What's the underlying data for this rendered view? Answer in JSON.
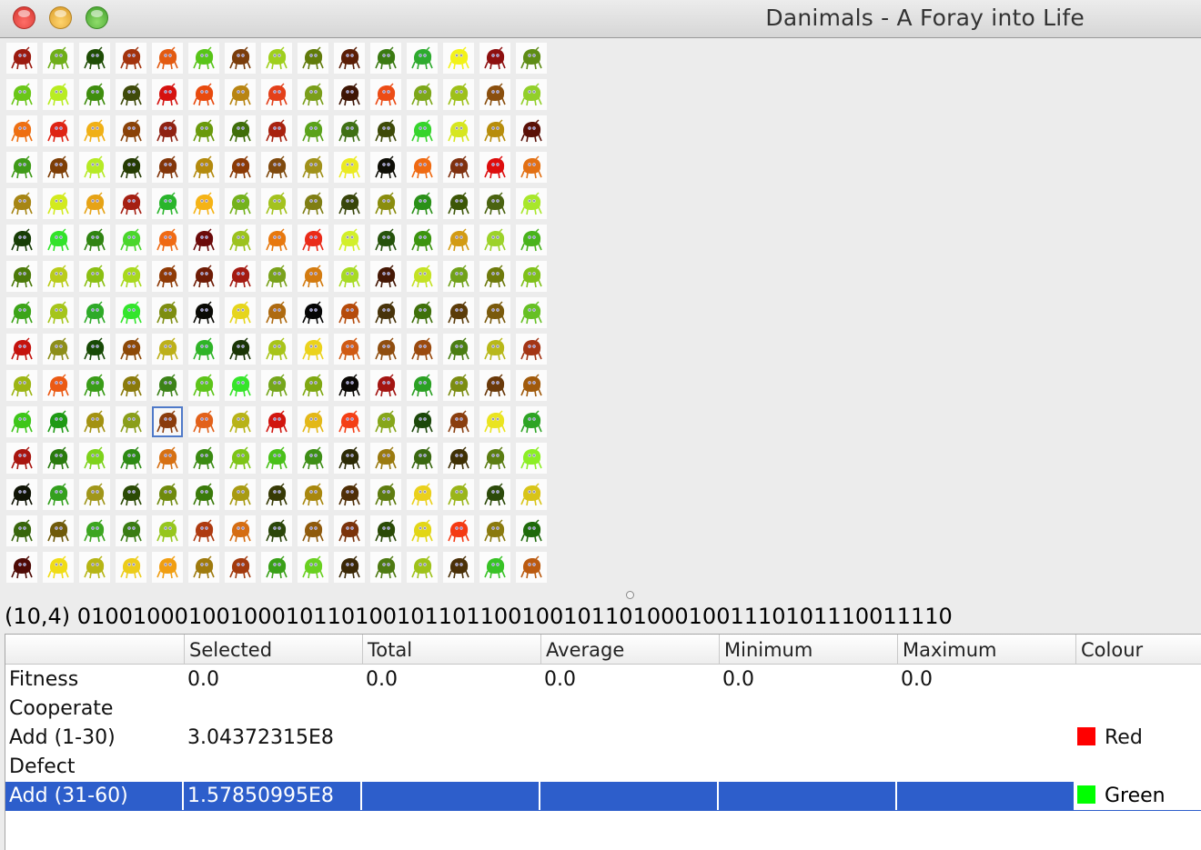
{
  "window": {
    "title": "Danimals - A Foray into Life"
  },
  "grid": {
    "rows": 15,
    "cols": 15,
    "selected": [
      10,
      4
    ],
    "colors": [
      [
        "#9b1b10",
        "#6fae1a",
        "#1f4d06",
        "#a2330d",
        "#e25b12",
        "#58c418",
        "#7a3d0b",
        "#9fcf1e",
        "#617b0b",
        "#5a1d05",
        "#3b7a12",
        "#2eaa2e",
        "#f2f21a",
        "#8d0f0f",
        "#5e8c16"
      ],
      [
        "#6ac618",
        "#b8ec22",
        "#3f8d0e",
        "#3f4a0a",
        "#d5120f",
        "#e84a0e",
        "#b88412",
        "#e3401a",
        "#7a9e1a",
        "#3e1505",
        "#ec4c16",
        "#7da71a",
        "#9ec01a",
        "#8a4f0e",
        "#92cf2a"
      ],
      [
        "#ee6f12",
        "#de2414",
        "#f0b016",
        "#8a4208",
        "#8f2212",
        "#6a9a0c",
        "#3f6e0a",
        "#a8220f",
        "#5aa21a",
        "#3f7014",
        "#3e4a08",
        "#36d42c",
        "#d6e61f",
        "#b78d0c",
        "#5a1006"
      ],
      [
        "#3f9a18",
        "#7d3e06",
        "#b6ea26",
        "#253b03",
        "#82360a",
        "#b38a0e",
        "#8a3a06",
        "#7f4a0e",
        "#a0911a",
        "#eaea22",
        "#0e0e06",
        "#ef6a12",
        "#7f3110",
        "#dd0d0d",
        "#e27014"
      ],
      [
        "#a68514",
        "#d2ea1e",
        "#e6a316",
        "#a51f12",
        "#29b52b",
        "#f5b316",
        "#74b21c",
        "#a3c21e",
        "#7f7e14",
        "#38450a",
        "#8a8d0e",
        "#2a9018",
        "#3c5606",
        "#4a6310",
        "#a8e72a"
      ],
      [
        "#173d06",
        "#32e22a",
        "#308412",
        "#4ad62c",
        "#ef6a14",
        "#6b0a0a",
        "#9cc21e",
        "#e7780e",
        "#ea2a18",
        "#d2ef2a",
        "#26530c",
        "#3c940e",
        "#d29b14",
        "#9cd22a",
        "#49b31c"
      ],
      [
        "#4c7a0a",
        "#b9cc1a",
        "#8bbf14",
        "#a8d81e",
        "#8e3a06",
        "#6e1c06",
        "#a31a12",
        "#7aa21c",
        "#d37b10",
        "#a7da24",
        "#451805",
        "#c4e224",
        "#71a11a",
        "#6e7a0c",
        "#7fc01a"
      ],
      [
        "#3ca418",
        "#a5c51a",
        "#2eaa28",
        "#33e52c",
        "#7d8d10",
        "#0a0a05",
        "#e6d51c",
        "#ae6a10",
        "#050505",
        "#b54a0a",
        "#48330a",
        "#3f700a",
        "#5b3b08",
        "#7a5a0c",
        "#66c024"
      ],
      [
        "#c4130e",
        "#8d8e1a",
        "#184a06",
        "#8c4908",
        "#bdb01a",
        "#2fb428",
        "#1a3505",
        "#a8c41a",
        "#ebd21c",
        "#cf5a14",
        "#8f4e10",
        "#9a4a0e",
        "#4a7d12",
        "#b8b81a",
        "#a33515"
      ],
      [
        "#9db514",
        "#eb5a14",
        "#3a9c18",
        "#8a7a0c",
        "#3c8218",
        "#5ec41a",
        "#36e42a",
        "#75a61c",
        "#7fa812",
        "#0a0805",
        "#a31512",
        "#2ba024",
        "#7b8c12",
        "#6a390a",
        "#a05a0c"
      ],
      [
        "#3ec61a",
        "#1e9a14",
        "#a39212",
        "#8a9e1a",
        "#8a3c0c",
        "#e2611a",
        "#b8b318",
        "#d1150e",
        "#e3b818",
        "#f43f15",
        "#86a61a",
        "#1c480a",
        "#8a3e0e",
        "#eae420",
        "#2da424"
      ],
      [
        "#a8150f",
        "#2a7a0e",
        "#7ed21c",
        "#2d8a14",
        "#d67114",
        "#3a8a12",
        "#7dc418",
        "#4ac01a",
        "#3e8e16",
        "#2c2a06",
        "#9a7a10",
        "#3a6810",
        "#3f3005",
        "#5b7d12",
        "#8cee26"
      ],
      [
        "#101406",
        "#34a01e",
        "#a0961a",
        "#2b4a05",
        "#6f8a0e",
        "#3a7a0a",
        "#a89a12",
        "#373a06",
        "#a8870e",
        "#4f2e06",
        "#5e7c10",
        "#ead01c",
        "#9ab51a",
        "#2c4a0a",
        "#d8c418"
      ],
      [
        "#38660c",
        "#6f5a0a",
        "#3ca520",
        "#3a7c14",
        "#96c61e",
        "#ae3a10",
        "#d56d12",
        "#2b460a",
        "#8f5a0c",
        "#7a320a",
        "#2a4a06",
        "#e2d616",
        "#f43a12",
        "#8a7a0e",
        "#1e6a0a"
      ],
      [
        "#4e0a05",
        "#f0dc16",
        "#b6b516",
        "#eccc1a",
        "#f09e12",
        "#9e7a0e",
        "#a23a0e",
        "#3aa018",
        "#69d020",
        "#3b2806",
        "#4e7a12",
        "#9ec21a",
        "#4a3008",
        "#38c226",
        "#ba5a10"
      ]
    ]
  },
  "status": {
    "genome_text": "(10,4) 010010001001000101101001011011001001011010001001110101110011110"
  },
  "table": {
    "columns": [
      "",
      "Selected",
      "Total",
      "Average",
      "Minimum",
      "Maximum",
      "Colour"
    ],
    "rows": [
      {
        "label": "Fitness",
        "selected": "0.0",
        "total": "0.0",
        "average": "0.0",
        "minimum": "0.0",
        "maximum": "0.0",
        "colour": ""
      },
      {
        "label": "Cooperate",
        "selected": "",
        "total": "",
        "average": "",
        "minimum": "",
        "maximum": "",
        "colour": ""
      },
      {
        "label": "Add (1-30)",
        "selected": "3.04372315E8",
        "total": "",
        "average": "",
        "minimum": "",
        "maximum": "",
        "colour": "Red",
        "swatch": "#ff0000"
      },
      {
        "label": "Defect",
        "selected": "",
        "total": "",
        "average": "",
        "minimum": "",
        "maximum": "",
        "colour": ""
      },
      {
        "label": "Add (31-60)",
        "selected": "1.57850995E8",
        "total": "",
        "average": "",
        "minimum": "",
        "maximum": "",
        "colour": "Green",
        "swatch": "#00ff00",
        "highlighted": true
      }
    ]
  }
}
